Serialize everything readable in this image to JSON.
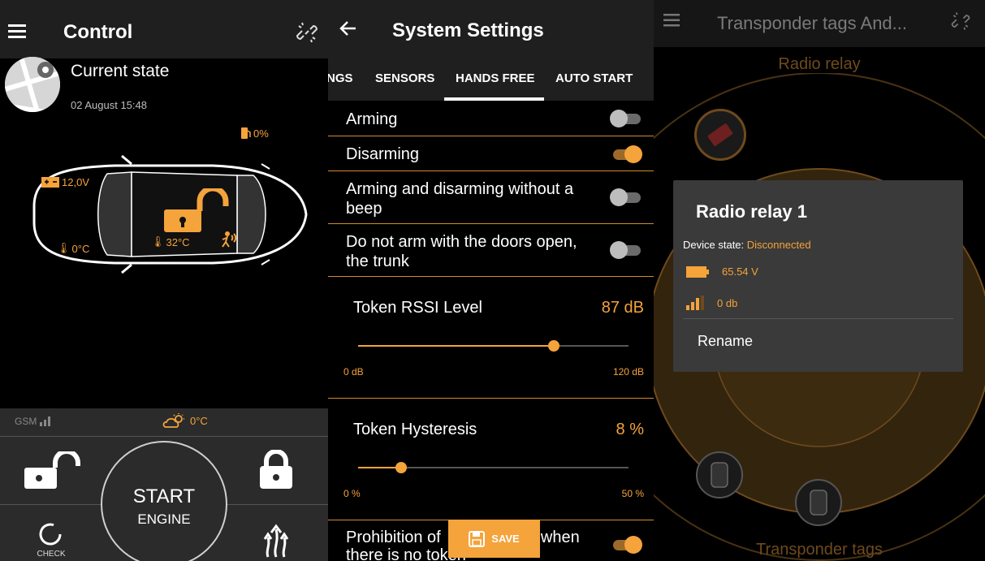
{
  "control": {
    "title": "Control",
    "state_title": "Current state",
    "state_date": "02 August 15:48",
    "fuel": "0%",
    "battery": "12,0V",
    "temp_left": "0°C",
    "temp_center": "32°C",
    "gsm": "GSM",
    "weather_temp": "0°C",
    "start": "START",
    "engine": "ENGINE",
    "check": "CHECK"
  },
  "settings": {
    "title": "System Settings",
    "tabs": [
      "NGS",
      "SENSORS",
      "HANDS FREE",
      "AUTO START"
    ],
    "active_tab": "HANDS FREE",
    "toggles": [
      {
        "label": "Arming",
        "on": false
      },
      {
        "label": "Disarming",
        "on": true
      },
      {
        "label": "Arming and disarming without a beep",
        "on": false
      },
      {
        "label": "Do not arm with the doors open, the trunk",
        "on": false
      }
    ],
    "rssi": {
      "label": "Token RSSI Level",
      "value": "87 dB",
      "min": "0 dB",
      "max": "120 dB",
      "fraction": 0.725
    },
    "hysteresis": {
      "label": "Token Hysteresis",
      "value": "8  %",
      "min": "0  %",
      "max": "50  %",
      "fraction": 0.16
    },
    "last_toggle": {
      "label_part1": "Prohibition of",
      "label_part2": "when",
      "label_part3": "there is no token",
      "on": true
    },
    "save": "SAVE"
  },
  "relay": {
    "title": "Transponder tags And...",
    "section_top": "Radio relay",
    "section_bottom": "Transponder tags",
    "dialog": {
      "title": "Radio relay 1",
      "state_label": "Device state:",
      "state_value": "Disconnected",
      "battery": "65.54 V",
      "signal": "0 db",
      "rename": "Rename"
    }
  },
  "colors": {
    "accent": "#f5a33b",
    "bar": "#1f1f1f",
    "dialog": "#3a3a3a"
  }
}
